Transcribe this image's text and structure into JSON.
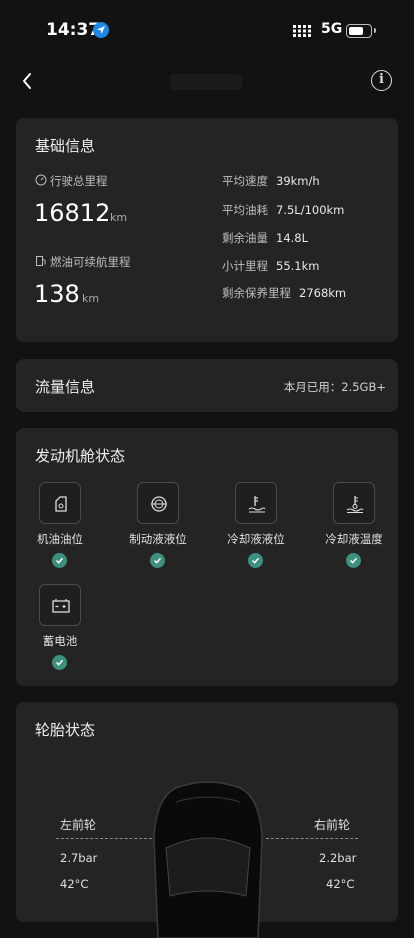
{
  "status_bar": {
    "time": "14:37",
    "network": "5G"
  },
  "nav": {
    "info_symbol": "i"
  },
  "basic_info": {
    "title": "基础信息",
    "odometer": {
      "label": "行驶总里程",
      "value": "16812",
      "unit": "km"
    },
    "fuel_range": {
      "label": "燃油可续航里程",
      "value": "138",
      "unit": "km"
    },
    "details": [
      {
        "label": "平均速度",
        "value": "39km/h"
      },
      {
        "label": "平均油耗",
        "value": "7.5L/100km"
      },
      {
        "label": "剩余油量",
        "value": "14.8L"
      },
      {
        "label": "小计里程",
        "value": "55.1km"
      },
      {
        "label": "剩余保养里程",
        "value": "2768km"
      }
    ]
  },
  "traffic": {
    "title": "流量信息",
    "used_label": "本月已用：",
    "used_value": "2.5GB+"
  },
  "engine": {
    "title": "发动机舱状态",
    "items": [
      {
        "label": "机油油位",
        "icon": "oil-can-icon",
        "status": "ok"
      },
      {
        "label": "制动液液位",
        "icon": "brake-fluid-icon",
        "status": "ok"
      },
      {
        "label": "冷却液液位",
        "icon": "coolant-level-icon",
        "status": "ok"
      },
      {
        "label": "冷却液温度",
        "icon": "coolant-temperature-icon",
        "status": "ok"
      },
      {
        "label": "蓄电池",
        "icon": "battery-icon",
        "status": "ok"
      }
    ]
  },
  "tires": {
    "title": "轮胎状态",
    "front_left": {
      "label": "左前轮",
      "pressure": "2.7bar",
      "temperature": "42°C"
    },
    "front_right": {
      "label": "右前轮",
      "pressure": "2.2bar",
      "temperature": "42°C"
    }
  },
  "colors": {
    "background": "#121212",
    "card": "#242424",
    "ok_green": "#3e8f7c",
    "location_blue": "#1e88e5"
  }
}
